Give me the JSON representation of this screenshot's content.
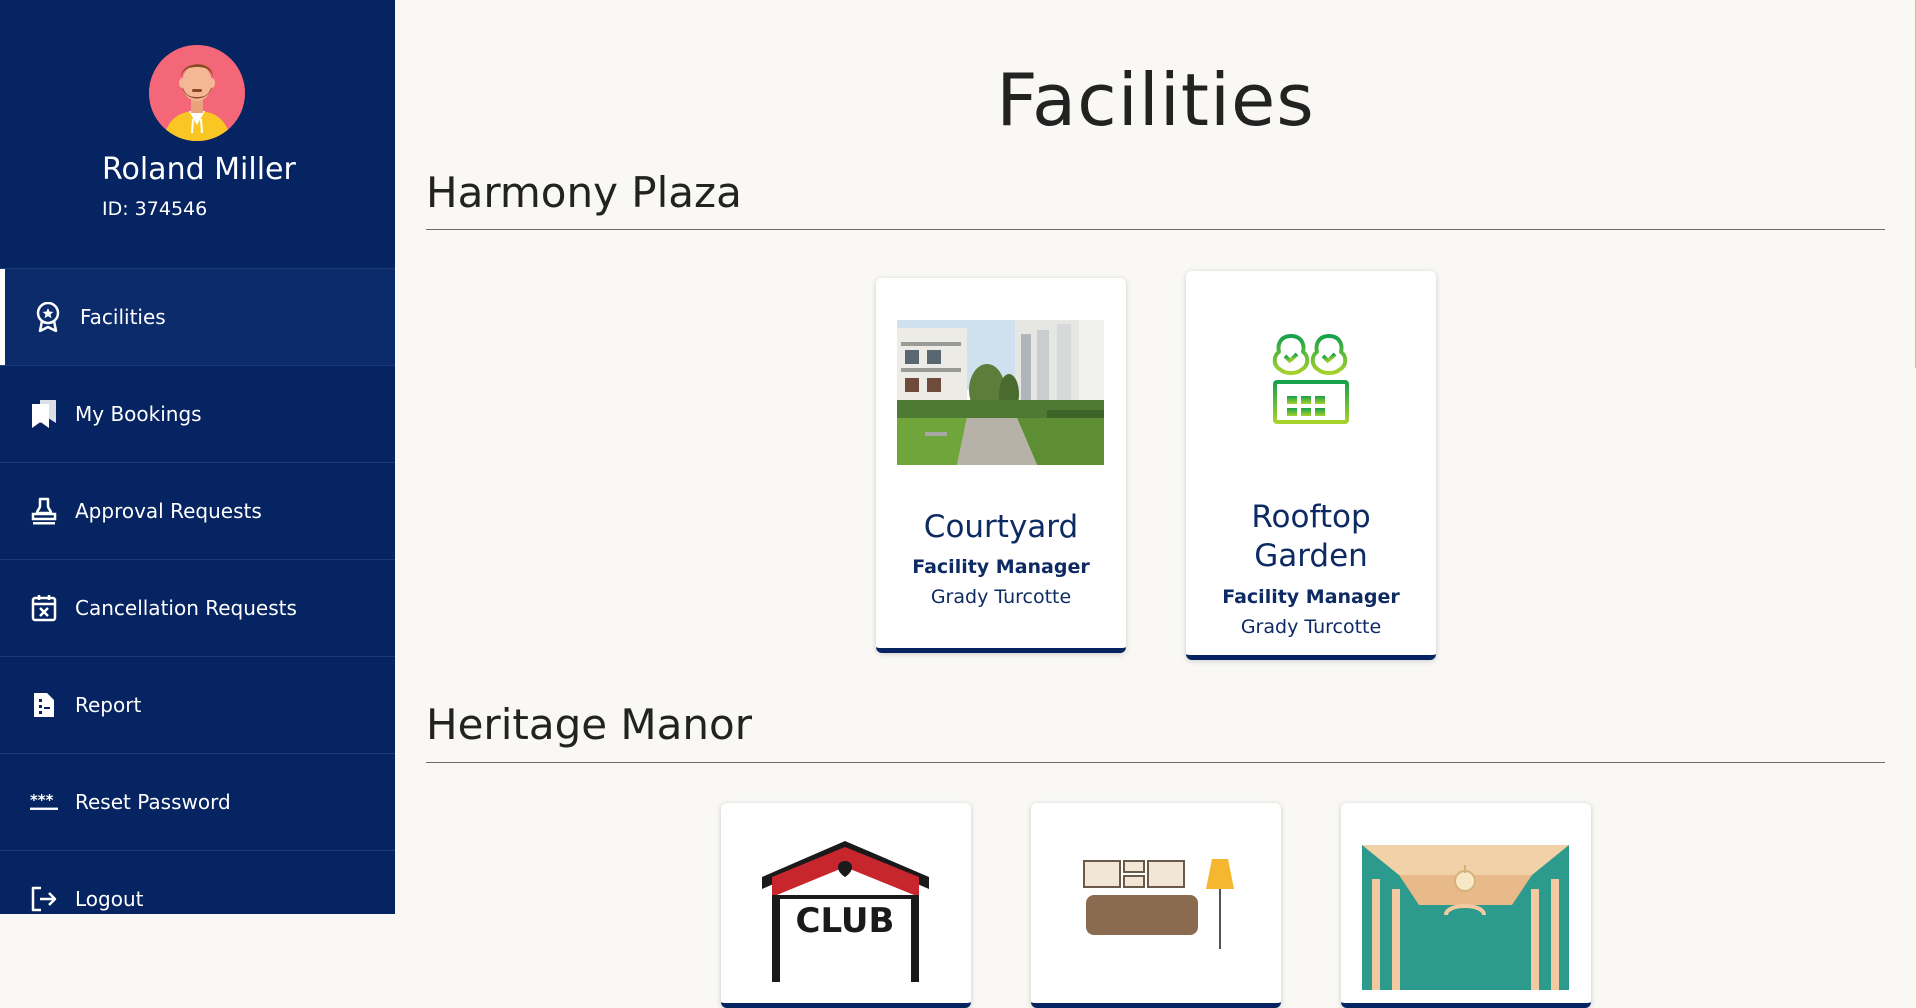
{
  "profile": {
    "name": "Roland Miller",
    "id_label": "ID: 374546"
  },
  "nav": {
    "items": [
      {
        "label": "Facilities",
        "icon": "award-star-icon",
        "active": true
      },
      {
        "label": "My Bookings",
        "icon": "bookmarks-icon",
        "active": false
      },
      {
        "label": "Approval Requests",
        "icon": "stamp-icon",
        "active": false
      },
      {
        "label": "Cancellation Requests",
        "icon": "calendar-x-icon",
        "active": false
      },
      {
        "label": "Report",
        "icon": "report-document-icon",
        "active": false
      },
      {
        "label": "Reset Password",
        "icon": "password-asterisk-icon",
        "active": false
      },
      {
        "label": "Logout",
        "icon": "logout-icon",
        "active": false
      }
    ]
  },
  "page": {
    "title": "Facilities"
  },
  "sections": [
    {
      "title": "Harmony Plaza",
      "facilities": [
        {
          "name": "Courtyard",
          "role": "Facility Manager",
          "manager": "Grady Turcotte",
          "image": "courtyard-photo"
        },
        {
          "name_line1": "Rooftop",
          "name_line2": "Garden",
          "role": "Facility Manager",
          "manager": "Grady Turcotte",
          "image": "rooftop-garden-icon"
        }
      ]
    },
    {
      "title": "Heritage Manor",
      "facilities": [
        {
          "image": "club-house-logo",
          "logo_text": "CLUB"
        },
        {
          "image": "lounge-furniture-illustration"
        },
        {
          "image": "ballroom-illustration"
        }
      ]
    }
  ],
  "colors": {
    "sidebar": "#062461",
    "accent": "#0d2a63",
    "background": "#f9f8f4"
  }
}
